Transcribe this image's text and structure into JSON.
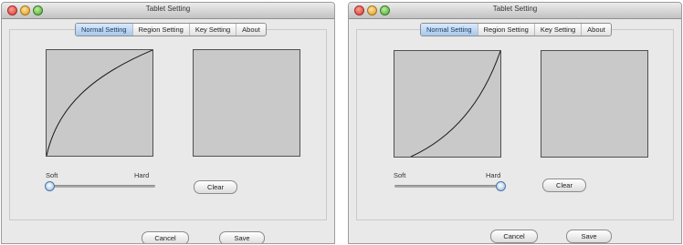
{
  "window_title": "Tablet Setting",
  "tabs": [
    "Normal Setting",
    "Region Setting",
    "Key Setting",
    "About"
  ],
  "active_tab_index": 0,
  "labels": {
    "soft": "Soft",
    "hard": "Hard"
  },
  "buttons": {
    "clear": "Clear",
    "cancel": "Cancel",
    "save": "Save"
  },
  "screens": [
    {
      "curve": "concave",
      "pressure_slider_value": 0.0
    },
    {
      "curve": "convex",
      "pressure_slider_value": 1.0
    }
  ]
}
